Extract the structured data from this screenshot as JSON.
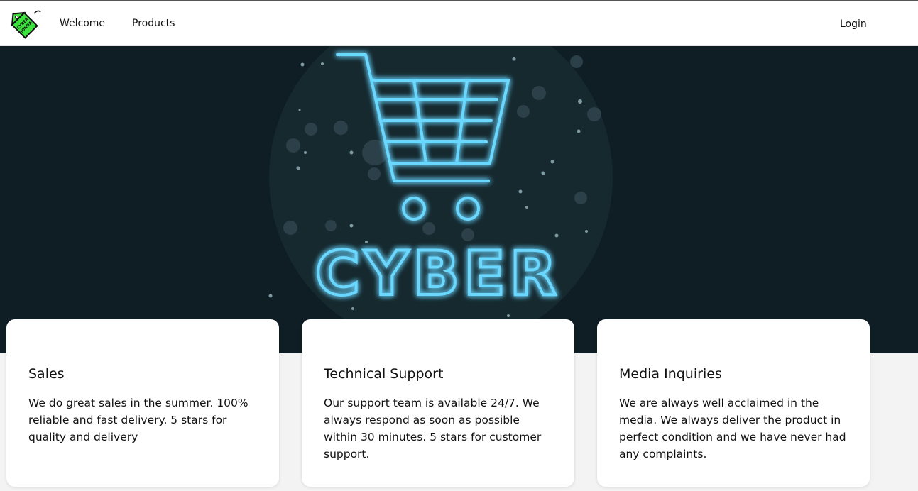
{
  "nav": {
    "logo_alt": "Cyber Monday",
    "logo_text_line1": "CYBER",
    "logo_text_line2": "MONDAY",
    "items": [
      {
        "label": "Welcome"
      },
      {
        "label": "Products"
      }
    ],
    "login_label": "Login"
  },
  "hero": {
    "neon_text": "CYBER",
    "colors": {
      "background": "#0f1e24",
      "neon": "#5fd0ff",
      "glow": "#1fa0ff"
    }
  },
  "cards": [
    {
      "title": "Sales",
      "text": "We do great sales in the summer. 100% reliable and fast delivery. 5 stars for quality and delivery"
    },
    {
      "title": "Technical Support",
      "text": "Our support team is available 24/7. We always respond as soon as possible within 30 minutes. 5 stars for customer support."
    },
    {
      "title": "Media Inquiries",
      "text": "We are always well acclaimed in the media. We always deliver the product in perfect condition and we have never had any complaints."
    }
  ]
}
